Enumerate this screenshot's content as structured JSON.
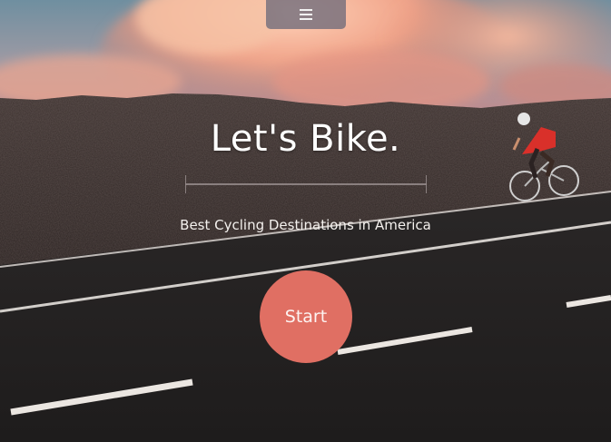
{
  "nav": {
    "menu_icon": "hamburger-menu-icon"
  },
  "hero": {
    "title": "Let's Bike.",
    "subtitle": "Best Cycling Destinations in America",
    "start_label": "Start",
    "background_description_icon": "cyclist-road-photo"
  },
  "colors": {
    "accent": "#e06f63",
    "menu_bg": "#6e6a7a",
    "text": "#ffffff"
  }
}
